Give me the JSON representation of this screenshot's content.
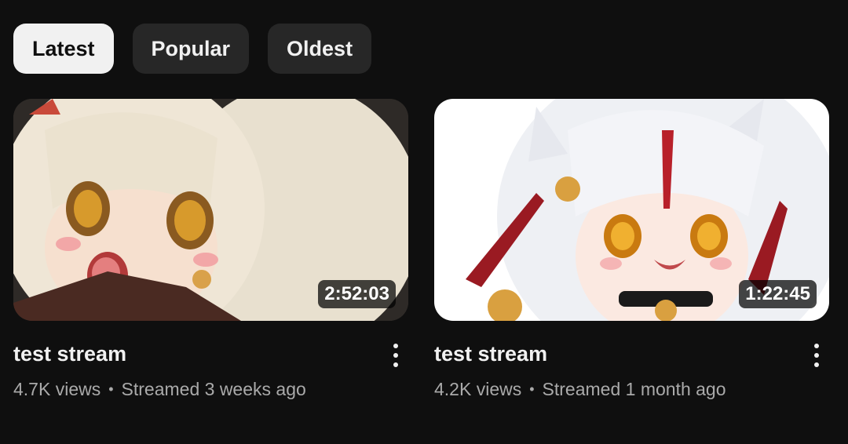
{
  "filters": [
    {
      "label": "Latest",
      "active": true
    },
    {
      "label": "Popular",
      "active": false
    },
    {
      "label": "Oldest",
      "active": false
    }
  ],
  "videos": [
    {
      "title": "test stream",
      "duration": "2:52:03",
      "views": "4.7K views",
      "separator": "•",
      "age": "Streamed 3 weeks ago"
    },
    {
      "title": "test stream",
      "duration": "1:22:45",
      "views": "4.2K views",
      "separator": "•",
      "age": "Streamed 1 month ago"
    }
  ]
}
